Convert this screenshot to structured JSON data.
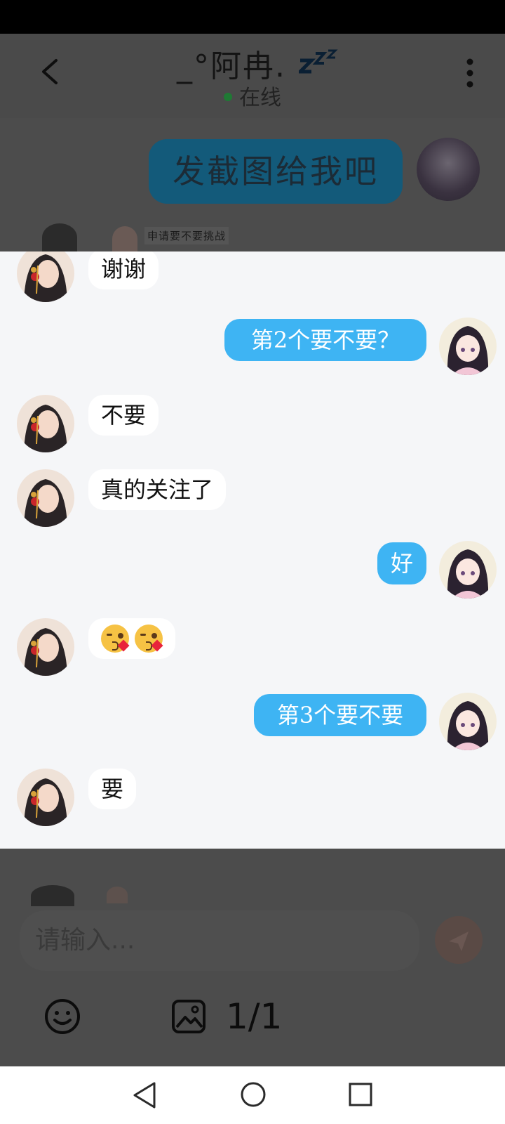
{
  "header": {
    "title": "_°阿冉.",
    "zzz": "zzz",
    "status": "在线"
  },
  "background": {
    "bubble_text": "发截图给我吧",
    "small_text": "申请要不要挑战"
  },
  "messages": [
    {
      "side": "in",
      "text": "谢谢"
    },
    {
      "side": "out",
      "text": "第2个要不要？"
    },
    {
      "side": "in",
      "text": "不要"
    },
    {
      "side": "in",
      "text": "真的关注了"
    },
    {
      "side": "out",
      "text": "好"
    },
    {
      "side": "in",
      "emoji": [
        "kissing-heart-emoji",
        "kissing-heart-emoji"
      ]
    },
    {
      "side": "out",
      "text": "第3个要不要"
    },
    {
      "side": "in",
      "text": "要"
    }
  ],
  "input": {
    "placeholder": "请输入..."
  },
  "viewer": {
    "page_indicator": "1/1"
  },
  "icons": {
    "back": "back-chevron-icon",
    "more": "more-vertical-icon",
    "send": "send-icon",
    "emoji": "emoji-smile-icon",
    "image": "image-icon",
    "nav_back": "triangle-back-icon",
    "nav_home": "circle-home-icon",
    "nav_recent": "square-recent-icon"
  },
  "colors": {
    "outgoing_bubble": "#3eb4f3",
    "incoming_bubble": "#ffffff",
    "panel_bg": "#f5f6f8",
    "overlay": "#4c4c4c",
    "online_dot": "#1f7a34"
  }
}
